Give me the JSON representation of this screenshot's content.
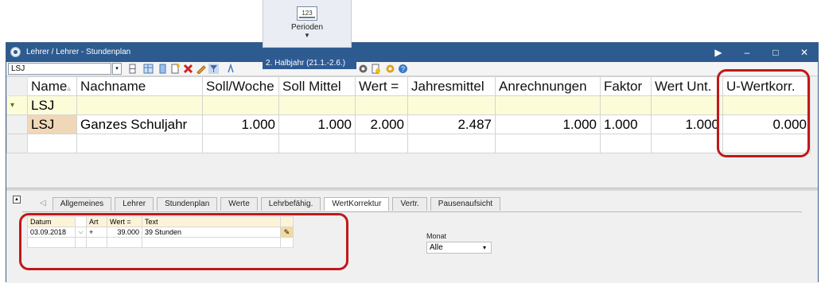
{
  "perioden": {
    "icon_text": "123",
    "label": "Perioden",
    "arrow": "▼",
    "selected": "2. Halbjahr (21.1.-2.6.)"
  },
  "window": {
    "title": "Lehrer / Lehrer - Stundenplan",
    "controls": {
      "pin": "▶",
      "minimize": "–",
      "maximize": "□",
      "close": "✕"
    }
  },
  "toolbar": {
    "combo_value": "LSJ"
  },
  "grid": {
    "headers": [
      "Name",
      "Nachname",
      "Soll/Woche",
      "Soll Mittel",
      "Wert =",
      "Jahresmittel",
      "Anrechnungen",
      "Faktor",
      "Wert Unt.",
      "U-Wertkorr."
    ],
    "sort_marker": "▵",
    "filter_row": {
      "marker": "▾",
      "name": "LSJ"
    },
    "data_row": {
      "name": "LSJ",
      "nachname": "Ganzes Schuljahr",
      "soll_woche": "1.000",
      "soll_mittel": "1.000",
      "wert": "2.000",
      "jahresmittel": "2.487",
      "anrechnungen": "1.000",
      "faktor": "1.000",
      "wert_unt": "1.000",
      "u_wertkorr": "0.000"
    }
  },
  "tabs": {
    "arrow": "◁",
    "items": [
      "Allgemeines",
      "Lehrer",
      "Stundenplan",
      "Werte",
      "Lehrbefähig.",
      "WertKorrektur",
      "Vertr.",
      "Pausenaufsicht"
    ],
    "active": "WertKorrektur"
  },
  "subgrid": {
    "headers": [
      "Datum",
      "Art",
      "Wert =",
      "Text"
    ],
    "row": {
      "datum": "03.09.2018",
      "art": "+",
      "wert": "39.000",
      "text": "39 Stunden"
    }
  },
  "monat": {
    "label": "Monat",
    "value": "Alle",
    "arrow": "▾"
  },
  "colors": {
    "titlebar": "#2d5b8f",
    "highlight": "#c01818",
    "filter_row": "#fdfcd8",
    "key_cell": "#f0d7b8"
  }
}
